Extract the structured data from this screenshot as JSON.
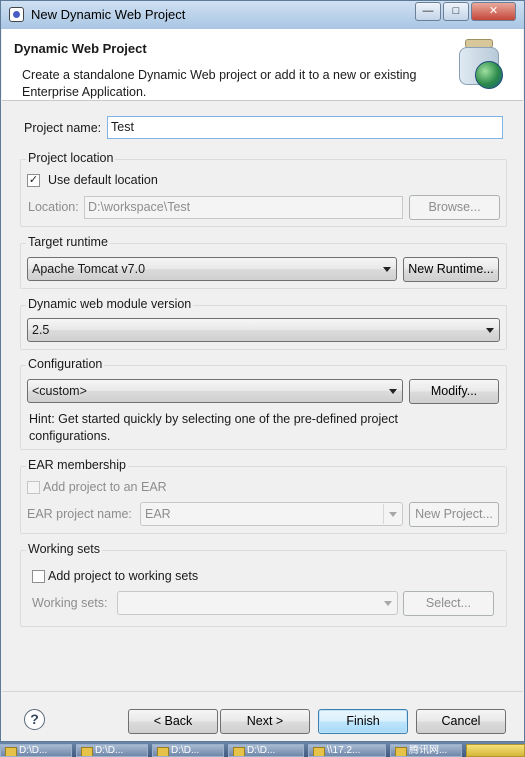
{
  "window": {
    "title": "New Dynamic Web Project",
    "controls": {
      "minimize": "—",
      "maximize": "□",
      "close": "✕"
    }
  },
  "header": {
    "title": "Dynamic Web Project",
    "description": "Create a standalone Dynamic Web project or add it to a new or existing Enterprise Application."
  },
  "project_name": {
    "label": "Project name:",
    "value": "Test"
  },
  "project_location": {
    "group_title": "Project location",
    "use_default_label": "Use default location",
    "use_default_checked": true,
    "location_label": "Location:",
    "location_value": "D:\\workspace\\Test",
    "browse_label": "Browse..."
  },
  "target_runtime": {
    "group_title": "Target runtime",
    "selected": "Apache Tomcat v7.0",
    "new_runtime_label": "New Runtime..."
  },
  "module_version": {
    "group_title": "Dynamic web module version",
    "selected": "2.5"
  },
  "configuration": {
    "group_title": "Configuration",
    "selected": "<custom>",
    "modify_label": "Modify...",
    "hint": "Hint: Get started quickly by selecting one of the pre-defined project configurations."
  },
  "ear_membership": {
    "group_title": "EAR membership",
    "add_label": "Add project to an EAR",
    "add_checked": false,
    "ear_name_label": "EAR project name:",
    "ear_name_value": "EAR",
    "new_project_label": "New Project..."
  },
  "working_sets": {
    "group_title": "Working sets",
    "add_label": "Add project to working sets",
    "add_checked": false,
    "sets_label": "Working sets:",
    "sets_value": "",
    "select_label": "Select..."
  },
  "footer": {
    "help_symbol": "?",
    "back_label": "< Back",
    "next_label": "Next >",
    "finish_label": "Finish",
    "cancel_label": "Cancel"
  },
  "taskbar": {
    "items": [
      "D:\\D...",
      "D:\\D...",
      "D:\\D...",
      "D:\\D...",
      "\\\\17.2...",
      "腾讯网..."
    ]
  }
}
